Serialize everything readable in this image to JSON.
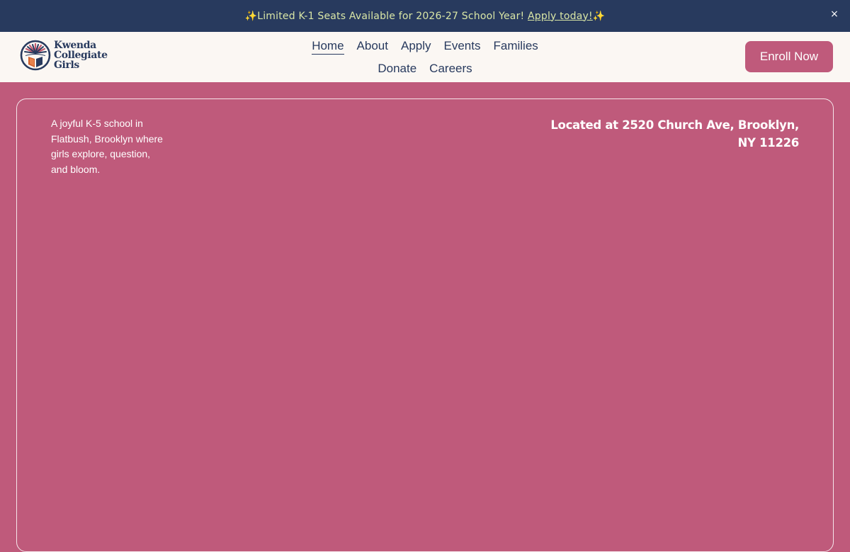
{
  "announcement": {
    "prefix_emoji": "✨",
    "text": "Limited K-1 Seats Available for 2026-27 School Year! ",
    "link_label": "Apply today!",
    "suffix_emoji": "✨",
    "close_label": "×"
  },
  "logo": {
    "line1": "Kwenda",
    "line2": "Collegiate",
    "line3": "Girls"
  },
  "nav": {
    "items": [
      {
        "label": "Home"
      },
      {
        "label": "About"
      },
      {
        "label": "Apply"
      },
      {
        "label": "Events"
      },
      {
        "label": "Families"
      },
      {
        "label": "Donate"
      },
      {
        "label": "Careers"
      }
    ]
  },
  "header": {
    "enroll_label": "Enroll Now"
  },
  "hero": {
    "tagline": "A joyful K-5 school in Flatbush, Brooklyn where girls explore, question, and bloom.",
    "address_line1": "Located at 2520 Church Ave, Brooklyn,",
    "address_line2": "NY 11226"
  },
  "colors": {
    "brand_navy": "#283a5e",
    "brand_pink": "#bf5a7b",
    "announce_text": "#d9e6a6",
    "header_bg": "#fbf7f3"
  }
}
